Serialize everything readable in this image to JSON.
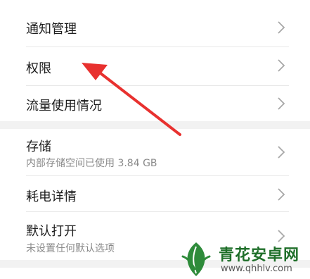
{
  "settings": {
    "notifications": {
      "title": "通知管理"
    },
    "permissions": {
      "title": "权限"
    },
    "data_usage": {
      "title": "流量使用情况"
    },
    "storage": {
      "title": "存储",
      "subtitle": "内部存储空间已使用 3.84 GB"
    },
    "power": {
      "title": "耗电详情"
    },
    "default_open": {
      "title": "默认打开",
      "subtitle": "未设置任何默认选项"
    }
  },
  "watermark": {
    "title": "青花安卓网",
    "url": "www.qhhlv.com"
  },
  "colors": {
    "annotation_arrow": "#e8312f",
    "watermark_green": "#1f6f2a"
  }
}
